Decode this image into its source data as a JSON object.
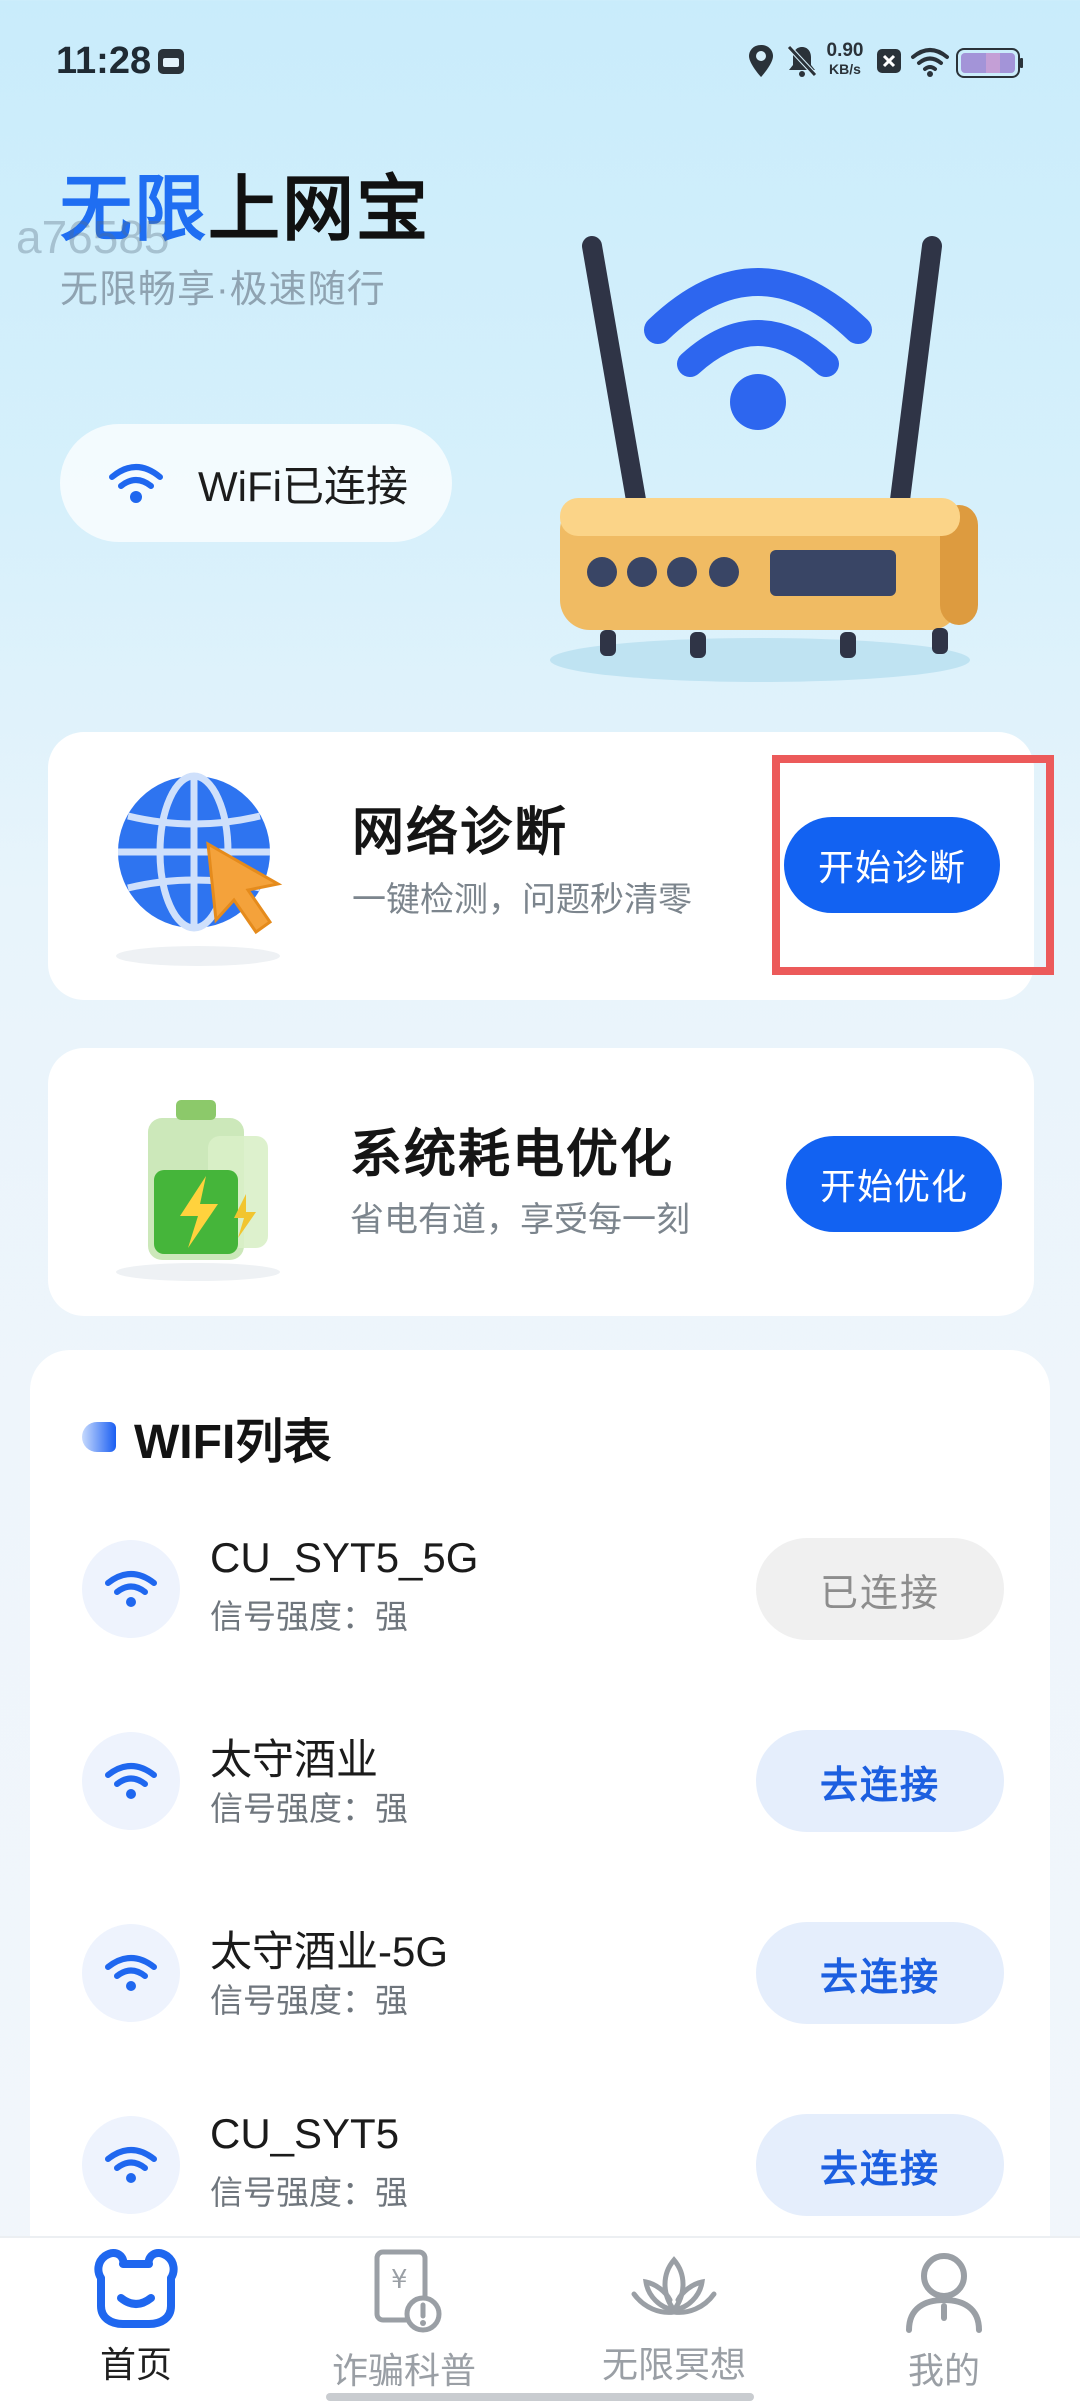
{
  "status_bar": {
    "time": "11:28",
    "net_speed_value": "0.90",
    "net_speed_unit": "KB/s",
    "icons": [
      "calendar-icon",
      "location-icon",
      "mute-icon",
      "x-icon",
      "wifi-signal-icon",
      "battery-icon"
    ]
  },
  "header": {
    "title_part1": "无限",
    "title_part2": "上网宝",
    "watermark": "a76585",
    "slogan": "无限畅享·极速随行",
    "wifi_status": "WiFi已连接"
  },
  "cards": {
    "diagnosis": {
      "title": "网络诊断",
      "subtitle": "一键检测，问题秒清零",
      "button": "开始诊断"
    },
    "battery": {
      "title": "系统耗电优化",
      "subtitle": "省电有道，享受每一刻",
      "button": "开始优化"
    }
  },
  "wifi_list": {
    "title": "WIFI列表",
    "items": [
      {
        "name": "CU_SYT5_5G",
        "strength": "信号强度：强",
        "button": "已连接",
        "state": "connected"
      },
      {
        "name": "太守酒业",
        "strength": "信号强度：强",
        "button": "去连接",
        "state": "available"
      },
      {
        "name": "太守酒业-5G",
        "strength": "信号强度：强",
        "button": "去连接",
        "state": "available"
      },
      {
        "name": "CU_SYT5",
        "strength": "信号强度：强",
        "button": "去连接",
        "state": "available"
      }
    ]
  },
  "bottom_nav": {
    "items": [
      {
        "label": "首页",
        "icon": "bear-home-icon",
        "active": true
      },
      {
        "label": "诈骗科普",
        "icon": "fraud-document-icon",
        "active": false
      },
      {
        "label": "无限冥想",
        "icon": "lotus-icon",
        "active": false
      },
      {
        "label": "我的",
        "icon": "user-icon",
        "active": false
      }
    ]
  },
  "colors": {
    "accent": "#1262f2",
    "highlight_border": "#ec5a5a",
    "title_blue": "#1f6ef2"
  }
}
